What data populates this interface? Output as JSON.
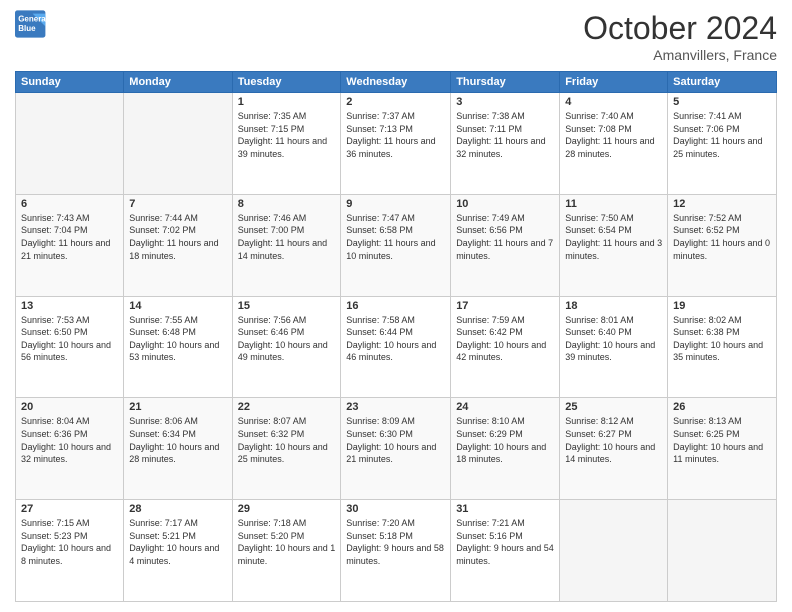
{
  "header": {
    "logo_line1": "General",
    "logo_line2": "Blue",
    "month": "October 2024",
    "location": "Amanvillers, France"
  },
  "weekdays": [
    "Sunday",
    "Monday",
    "Tuesday",
    "Wednesday",
    "Thursday",
    "Friday",
    "Saturday"
  ],
  "weeks": [
    [
      {
        "day": "",
        "info": ""
      },
      {
        "day": "",
        "info": ""
      },
      {
        "day": "1",
        "info": "Sunrise: 7:35 AM\nSunset: 7:15 PM\nDaylight: 11 hours and 39 minutes."
      },
      {
        "day": "2",
        "info": "Sunrise: 7:37 AM\nSunset: 7:13 PM\nDaylight: 11 hours and 36 minutes."
      },
      {
        "day": "3",
        "info": "Sunrise: 7:38 AM\nSunset: 7:11 PM\nDaylight: 11 hours and 32 minutes."
      },
      {
        "day": "4",
        "info": "Sunrise: 7:40 AM\nSunset: 7:08 PM\nDaylight: 11 hours and 28 minutes."
      },
      {
        "day": "5",
        "info": "Sunrise: 7:41 AM\nSunset: 7:06 PM\nDaylight: 11 hours and 25 minutes."
      }
    ],
    [
      {
        "day": "6",
        "info": "Sunrise: 7:43 AM\nSunset: 7:04 PM\nDaylight: 11 hours and 21 minutes."
      },
      {
        "day": "7",
        "info": "Sunrise: 7:44 AM\nSunset: 7:02 PM\nDaylight: 11 hours and 18 minutes."
      },
      {
        "day": "8",
        "info": "Sunrise: 7:46 AM\nSunset: 7:00 PM\nDaylight: 11 hours and 14 minutes."
      },
      {
        "day": "9",
        "info": "Sunrise: 7:47 AM\nSunset: 6:58 PM\nDaylight: 11 hours and 10 minutes."
      },
      {
        "day": "10",
        "info": "Sunrise: 7:49 AM\nSunset: 6:56 PM\nDaylight: 11 hours and 7 minutes."
      },
      {
        "day": "11",
        "info": "Sunrise: 7:50 AM\nSunset: 6:54 PM\nDaylight: 11 hours and 3 minutes."
      },
      {
        "day": "12",
        "info": "Sunrise: 7:52 AM\nSunset: 6:52 PM\nDaylight: 11 hours and 0 minutes."
      }
    ],
    [
      {
        "day": "13",
        "info": "Sunrise: 7:53 AM\nSunset: 6:50 PM\nDaylight: 10 hours and 56 minutes."
      },
      {
        "day": "14",
        "info": "Sunrise: 7:55 AM\nSunset: 6:48 PM\nDaylight: 10 hours and 53 minutes."
      },
      {
        "day": "15",
        "info": "Sunrise: 7:56 AM\nSunset: 6:46 PM\nDaylight: 10 hours and 49 minutes."
      },
      {
        "day": "16",
        "info": "Sunrise: 7:58 AM\nSunset: 6:44 PM\nDaylight: 10 hours and 46 minutes."
      },
      {
        "day": "17",
        "info": "Sunrise: 7:59 AM\nSunset: 6:42 PM\nDaylight: 10 hours and 42 minutes."
      },
      {
        "day": "18",
        "info": "Sunrise: 8:01 AM\nSunset: 6:40 PM\nDaylight: 10 hours and 39 minutes."
      },
      {
        "day": "19",
        "info": "Sunrise: 8:02 AM\nSunset: 6:38 PM\nDaylight: 10 hours and 35 minutes."
      }
    ],
    [
      {
        "day": "20",
        "info": "Sunrise: 8:04 AM\nSunset: 6:36 PM\nDaylight: 10 hours and 32 minutes."
      },
      {
        "day": "21",
        "info": "Sunrise: 8:06 AM\nSunset: 6:34 PM\nDaylight: 10 hours and 28 minutes."
      },
      {
        "day": "22",
        "info": "Sunrise: 8:07 AM\nSunset: 6:32 PM\nDaylight: 10 hours and 25 minutes."
      },
      {
        "day": "23",
        "info": "Sunrise: 8:09 AM\nSunset: 6:30 PM\nDaylight: 10 hours and 21 minutes."
      },
      {
        "day": "24",
        "info": "Sunrise: 8:10 AM\nSunset: 6:29 PM\nDaylight: 10 hours and 18 minutes."
      },
      {
        "day": "25",
        "info": "Sunrise: 8:12 AM\nSunset: 6:27 PM\nDaylight: 10 hours and 14 minutes."
      },
      {
        "day": "26",
        "info": "Sunrise: 8:13 AM\nSunset: 6:25 PM\nDaylight: 10 hours and 11 minutes."
      }
    ],
    [
      {
        "day": "27",
        "info": "Sunrise: 7:15 AM\nSunset: 5:23 PM\nDaylight: 10 hours and 8 minutes."
      },
      {
        "day": "28",
        "info": "Sunrise: 7:17 AM\nSunset: 5:21 PM\nDaylight: 10 hours and 4 minutes."
      },
      {
        "day": "29",
        "info": "Sunrise: 7:18 AM\nSunset: 5:20 PM\nDaylight: 10 hours and 1 minute."
      },
      {
        "day": "30",
        "info": "Sunrise: 7:20 AM\nSunset: 5:18 PM\nDaylight: 9 hours and 58 minutes."
      },
      {
        "day": "31",
        "info": "Sunrise: 7:21 AM\nSunset: 5:16 PM\nDaylight: 9 hours and 54 minutes."
      },
      {
        "day": "",
        "info": ""
      },
      {
        "day": "",
        "info": ""
      }
    ]
  ]
}
